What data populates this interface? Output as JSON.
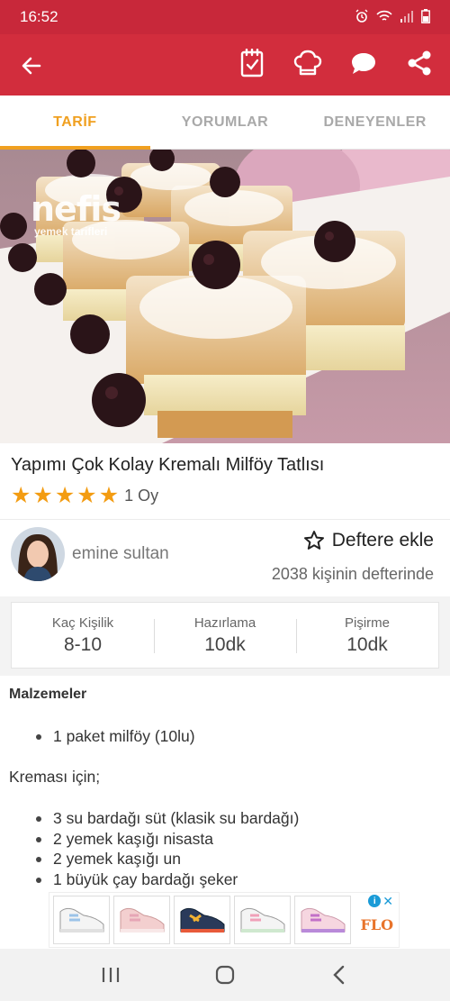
{
  "status_bar": {
    "time": "16:52"
  },
  "tabs": [
    {
      "label": "TARİF",
      "active": true
    },
    {
      "label": "YORUMLAR",
      "active": false
    },
    {
      "label": "DENEYENLER",
      "active": false
    }
  ],
  "hero": {
    "watermark_logo": "nefis",
    "watermark_sub": "yemek tarifleri"
  },
  "recipe": {
    "title": "Yapımı Çok Kolay Kremalı Milföy Tatlısı",
    "rating_stars": 5,
    "vote_count": "1 Oy"
  },
  "author": {
    "name": "emine sultan"
  },
  "bookmark": {
    "label": "Deftere ekle",
    "count_text": "2038 kişinin defterinde"
  },
  "stats": [
    {
      "label": "Kaç Kişilik",
      "value": "8-10"
    },
    {
      "label": "Hazırlama",
      "value": "10dk"
    },
    {
      "label": "Pişirme",
      "value": "10dk"
    }
  ],
  "ingredients": {
    "title": "Malzemeler",
    "main": [
      "1 paket milföy (10lu)"
    ],
    "cream_title": "Kreması için;",
    "cream": [
      "3 su bardağı süt (klasik su bardağı)",
      "2 yemek kaşığı nisasta",
      "2 yemek kaşığı un",
      "1 büyük çay bardağı şeker"
    ]
  },
  "ad": {
    "brand": "FLO"
  },
  "colors": {
    "primary": "#d22d3d",
    "accent": "#f0a020",
    "star": "#f39c12"
  }
}
